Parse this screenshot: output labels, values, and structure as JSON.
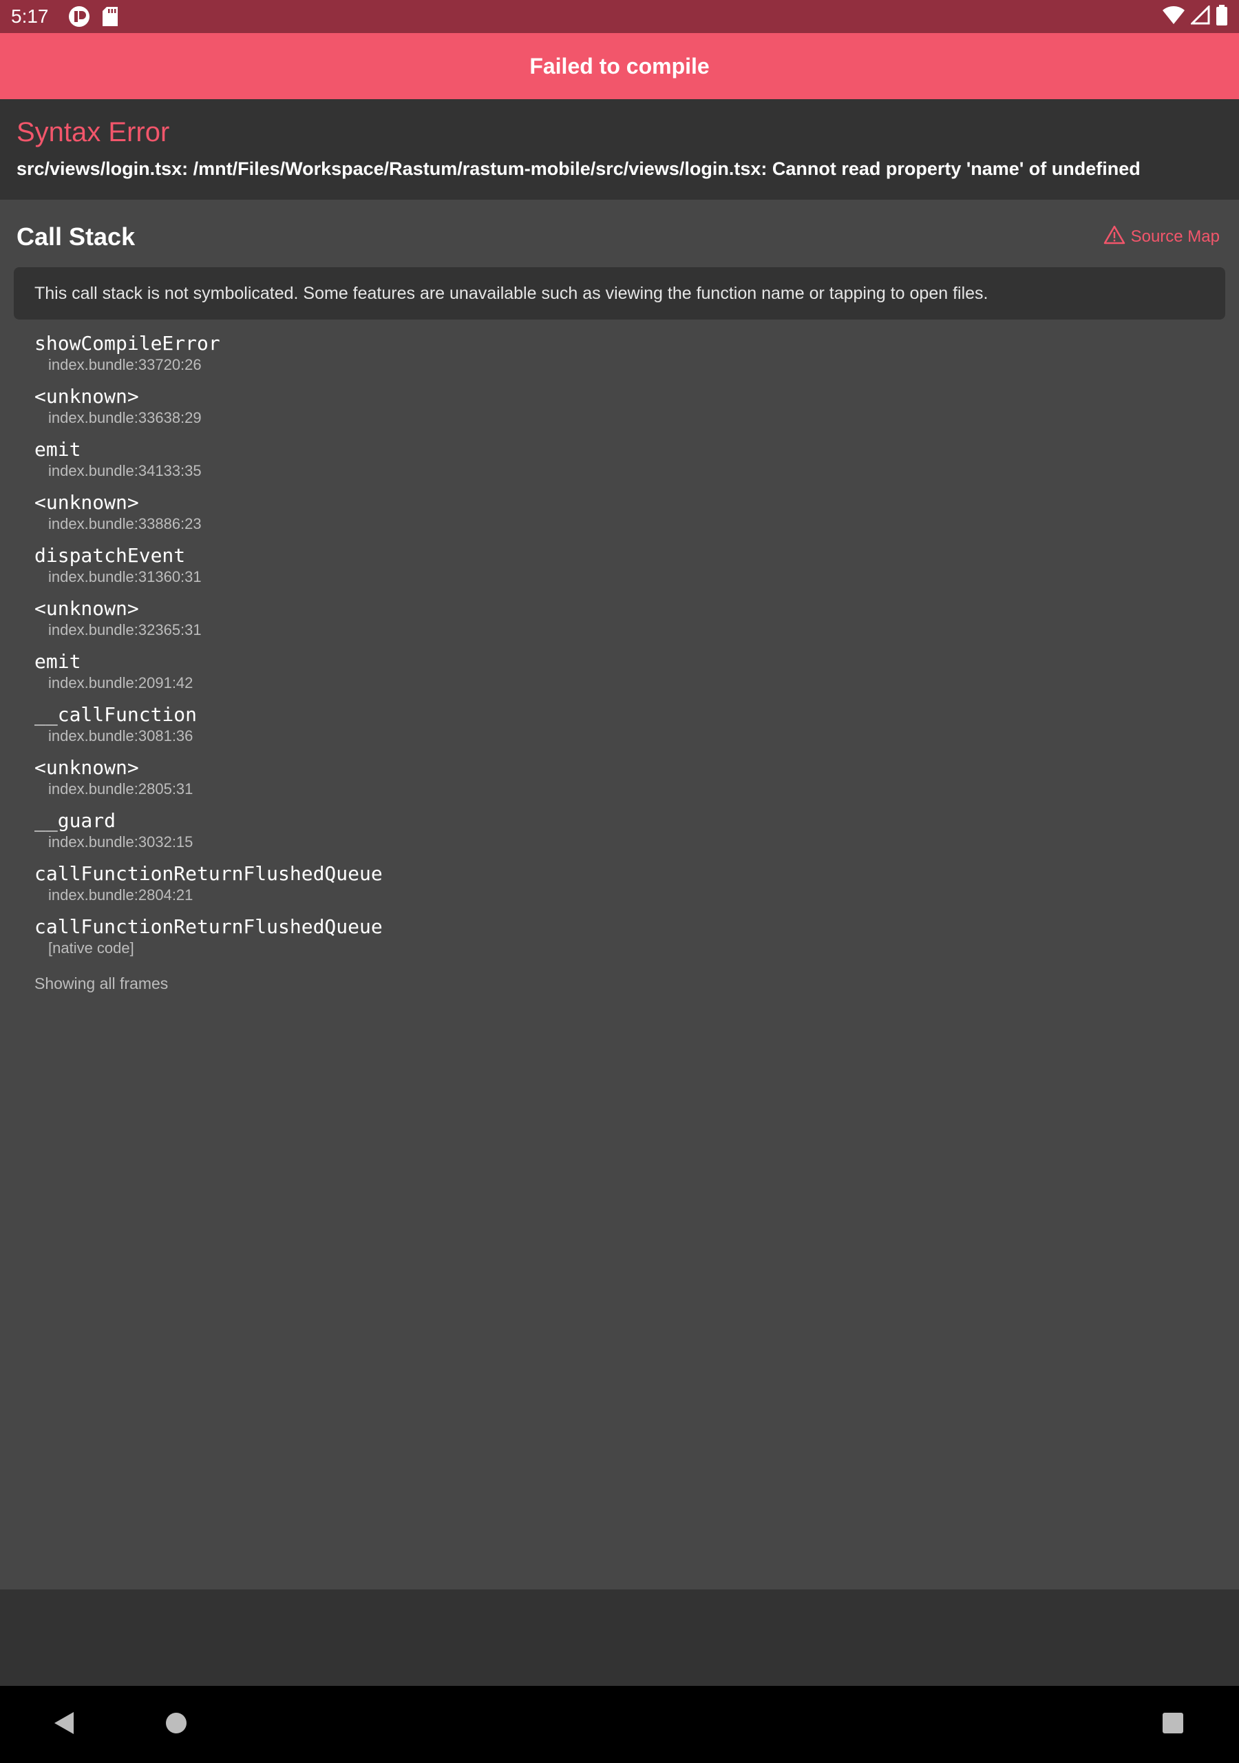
{
  "status_bar": {
    "time": "5:17",
    "icons_left": [
      "app-notification-icon",
      "sd-card-icon"
    ],
    "icons_right": [
      "wifi-icon",
      "signal-icon",
      "battery-icon"
    ]
  },
  "header": {
    "title": "Failed to compile"
  },
  "error": {
    "type": "Syntax Error",
    "message": "src/views/login.tsx: /mnt/Files/Workspace/Rastum/rastum-mobile/src/views/login.tsx: Cannot read property 'name' of undefined"
  },
  "call_stack": {
    "title": "Call Stack",
    "source_map_label": "Source Map",
    "notice": "This call stack is not symbolicated. Some features are unavailable such as viewing the function name or tapping to open files.",
    "frames": [
      {
        "name": "showCompileError",
        "location": "index.bundle:33720:26"
      },
      {
        "name": "<unknown>",
        "location": "index.bundle:33638:29"
      },
      {
        "name": "emit",
        "location": "index.bundle:34133:35"
      },
      {
        "name": "<unknown>",
        "location": "index.bundle:33886:23"
      },
      {
        "name": "dispatchEvent",
        "location": "index.bundle:31360:31"
      },
      {
        "name": "<unknown>",
        "location": "index.bundle:32365:31"
      },
      {
        "name": "emit",
        "location": "index.bundle:2091:42"
      },
      {
        "name": "__callFunction",
        "location": "index.bundle:3081:36"
      },
      {
        "name": "<unknown>",
        "location": "index.bundle:2805:31"
      },
      {
        "name": "__guard",
        "location": "index.bundle:3032:15"
      },
      {
        "name": "callFunctionReturnFlushedQueue",
        "location": "index.bundle:2804:21"
      },
      {
        "name": "callFunctionReturnFlushedQueue",
        "location": "[native code]"
      }
    ],
    "footer_text": "Showing all frames"
  },
  "colors": {
    "accent": "#f2566b",
    "status_bar": "#922f3f",
    "background": "#474747",
    "panel": "#333333"
  },
  "nav_bar": {
    "buttons": [
      "back-icon",
      "home-icon",
      "recents-icon"
    ]
  }
}
